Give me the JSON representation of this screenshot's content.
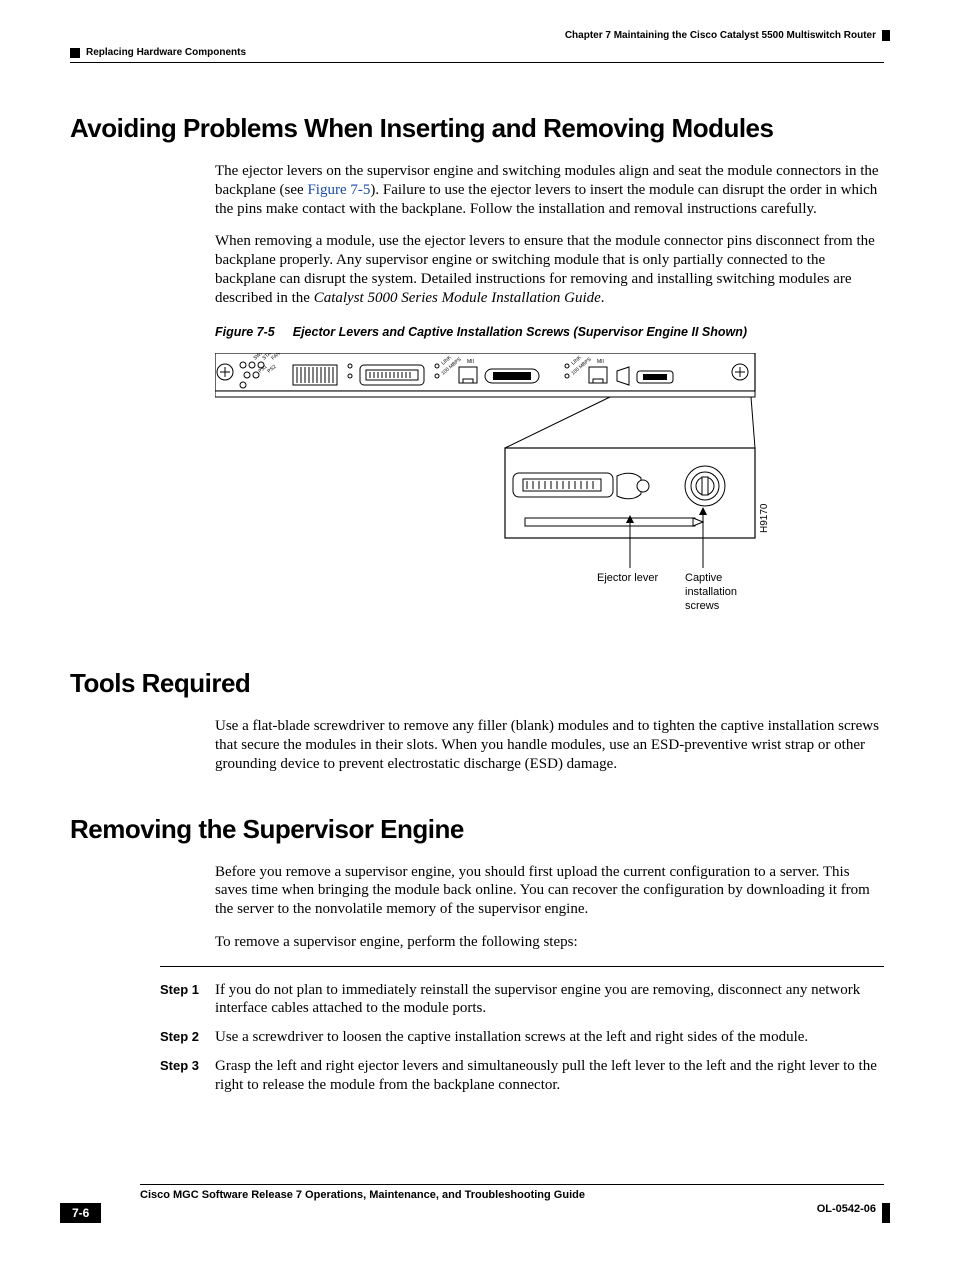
{
  "header": {
    "chapter_line": "Chapter 7      Maintaining the Cisco Catalyst 5500 Multiswitch Router",
    "subsection": "Replacing Hardware Components"
  },
  "sections": {
    "s1": {
      "title": "Avoiding Problems When Inserting and Removing Modules",
      "p1a": "The ejector levers on the supervisor engine and switching modules align and seat the module connectors in the backplane (see ",
      "figref": "Figure 7-5",
      "p1b": "). Failure to use the ejector levers to insert the module can disrupt the order in which the pins make contact with the backplane. Follow the installation and removal instructions carefully.",
      "p2a": "When removing a module, use the ejector levers to ensure that the module connector pins disconnect from the backplane properly. Any supervisor engine or switching module that is only partially connected to the backplane can disrupt the system. Detailed instructions for removing and installing switching modules are described in the ",
      "p2_em": "Catalyst 5000 Series Module Installation Guide",
      "p2b": "."
    },
    "figure": {
      "label": "Figure 7-5",
      "title": "Ejector Levers and Captive Installation Screws (Supervisor Engine II Shown)",
      "id": "H9170",
      "callout1": "Ejector lever",
      "callout2a": "Captive",
      "callout2b": "installation",
      "callout2c": "screws",
      "tiny_labels": [
        "SWITCH",
        "STATUS",
        "FAN",
        "PS1",
        "PS2",
        "LINK",
        "100 MBPS",
        "LINK",
        "100 MBPS",
        "MII",
        "MII"
      ]
    },
    "s2": {
      "title": "Tools Required",
      "p1": "Use a flat-blade screwdriver to remove any filler (blank) modules and to tighten the captive installation screws that secure the modules in their slots. When you handle modules, use an ESD-preventive wrist strap or other grounding device to prevent electrostatic discharge (ESD) damage."
    },
    "s3": {
      "title": "Removing the Supervisor Engine",
      "p1": "Before you remove a supervisor engine, you should first upload the current configuration to a server. This saves time when bringing the module back online. You can recover the configuration by downloading it from the server to the nonvolatile memory of the supervisor engine.",
      "p2": "To remove a supervisor engine, perform the following steps:",
      "steps": [
        {
          "label": "Step 1",
          "text": "If you do not plan to immediately reinstall the supervisor engine you are removing, disconnect any network interface cables attached to the module ports."
        },
        {
          "label": "Step 2",
          "text": "Use a screwdriver to loosen the captive installation screws at the left and right sides of the module."
        },
        {
          "label": "Step 3",
          "text": "Grasp the left and right ejector levers and simultaneously pull the left lever to the left and the right lever to the right to release the module from the backplane connector."
        }
      ]
    }
  },
  "footer": {
    "guide_title": "Cisco MGC Software Release 7 Operations, Maintenance, and Troubleshooting Guide",
    "page_num": "7-6",
    "doc_id": "OL-0542-06"
  }
}
